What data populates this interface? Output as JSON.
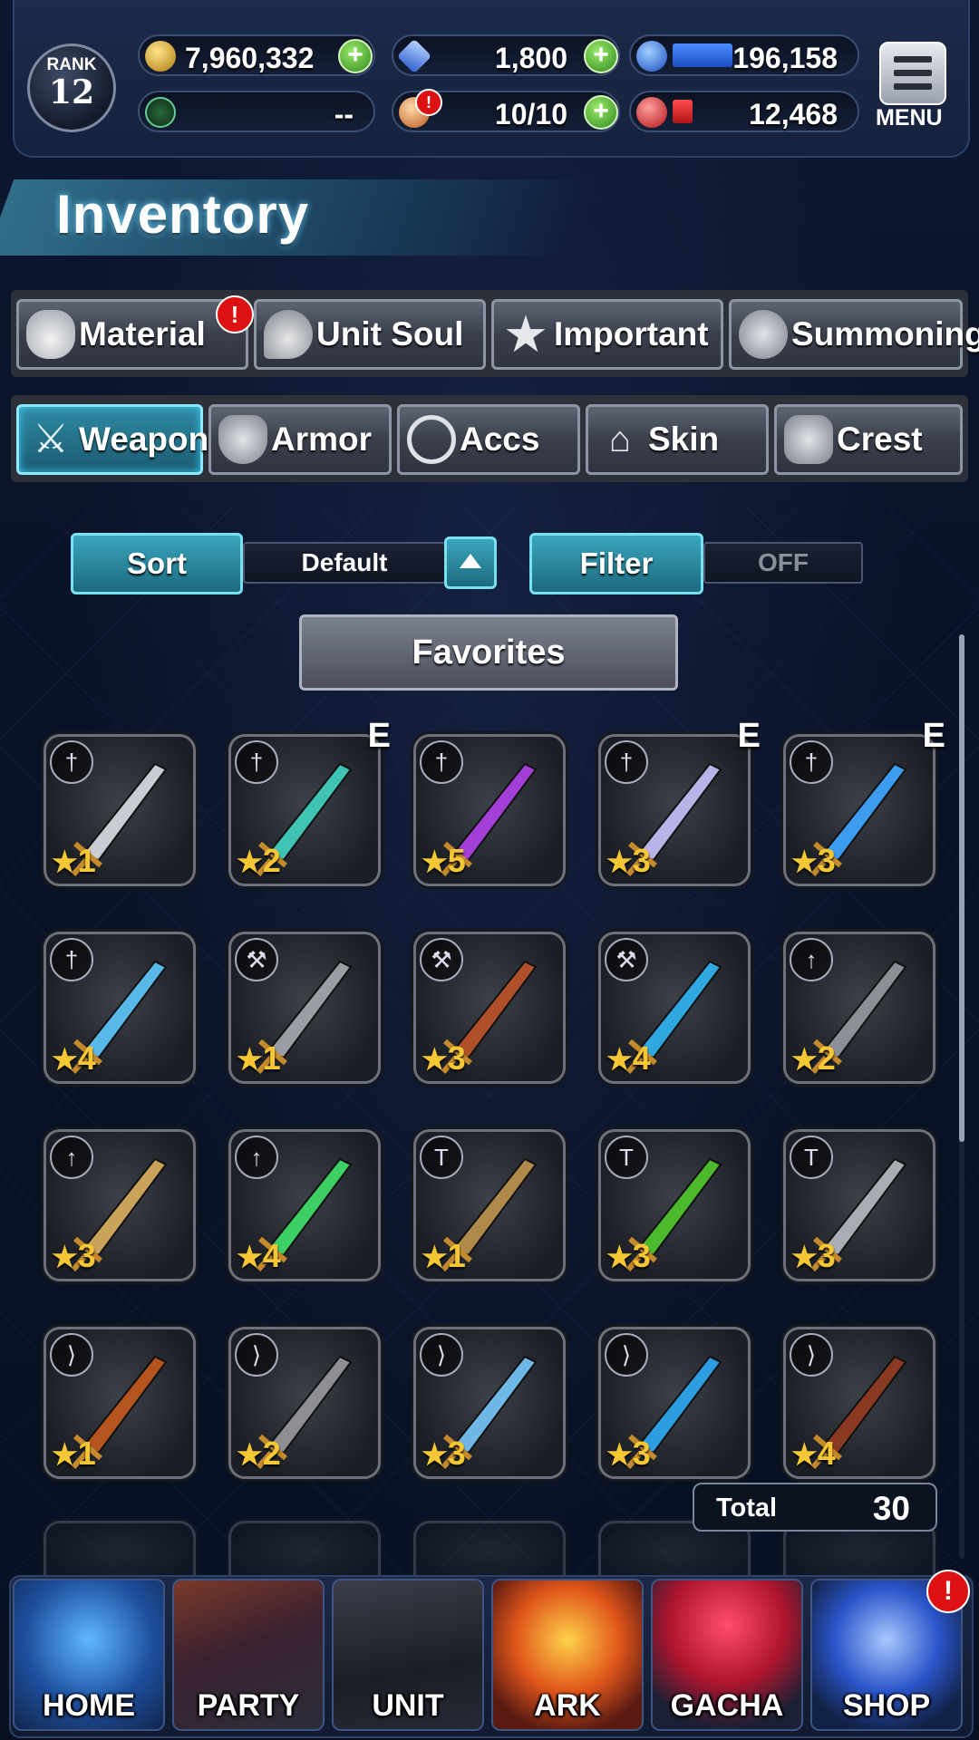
{
  "status": {
    "rank_label": "RANK",
    "rank_value": "12",
    "gil": "7,960,332",
    "lapis": "1,800",
    "energy_blue": "196,158",
    "arena_orb": "--",
    "stamina": "10/10",
    "energy_red": "12,468",
    "menu_label": "MENU"
  },
  "page": {
    "title": "Inventory"
  },
  "categories": [
    {
      "label": "Material",
      "alert": "!"
    },
    {
      "label": "Unit Soul"
    },
    {
      "label": "Important"
    },
    {
      "label": "Summoning"
    }
  ],
  "equip_tabs": [
    {
      "label": "Weapon",
      "active": true
    },
    {
      "label": "Armor"
    },
    {
      "label": "Accs"
    },
    {
      "label": "Skin"
    },
    {
      "label": "Crest"
    }
  ],
  "controls": {
    "sort_label": "Sort",
    "sort_value": "Default",
    "filter_label": "Filter",
    "filter_value": "OFF",
    "favorites_label": "Favorites"
  },
  "items": [
    {
      "type_icon": "sword-icon",
      "rarity": "1",
      "equipped": "",
      "color": "#c9ccd3"
    },
    {
      "type_icon": "sword-icon",
      "rarity": "2",
      "equipped": "E",
      "color": "#3fc4b4"
    },
    {
      "type_icon": "sword-icon",
      "rarity": "5",
      "equipped": "",
      "color": "#a13fd6"
    },
    {
      "type_icon": "sword-icon",
      "rarity": "3",
      "equipped": "E",
      "color": "#b9b4e8"
    },
    {
      "type_icon": "sword-icon",
      "rarity": "3",
      "equipped": "E",
      "color": "#3b9cf0"
    },
    {
      "type_icon": "sword-icon",
      "rarity": "4",
      "equipped": "",
      "color": "#58b9e8"
    },
    {
      "type_icon": "axe-icon",
      "rarity": "1",
      "equipped": "",
      "color": "#9a9da3"
    },
    {
      "type_icon": "axe-icon",
      "rarity": "3",
      "equipped": "",
      "color": "#b0502a"
    },
    {
      "type_icon": "axe-icon",
      "rarity": "4",
      "equipped": "",
      "color": "#2fa8e0"
    },
    {
      "type_icon": "spear-icon",
      "rarity": "2",
      "equipped": "",
      "color": "#8c9096"
    },
    {
      "type_icon": "spear-icon",
      "rarity": "3",
      "equipped": "",
      "color": "#c9a35a"
    },
    {
      "type_icon": "spear-icon",
      "rarity": "4",
      "equipped": "",
      "color": "#3ccf63"
    },
    {
      "type_icon": "hammer-icon",
      "rarity": "1",
      "equipped": "",
      "color": "#b08a4a"
    },
    {
      "type_icon": "hammer-icon",
      "rarity": "3",
      "equipped": "",
      "color": "#4cba2c"
    },
    {
      "type_icon": "hammer-icon",
      "rarity": "3",
      "equipped": "",
      "color": "#a9adb3"
    },
    {
      "type_icon": "bow-icon",
      "rarity": "1",
      "equipped": "",
      "color": "#b5541f"
    },
    {
      "type_icon": "bow-icon",
      "rarity": "2",
      "equipped": "",
      "color": "#8d8f93"
    },
    {
      "type_icon": "bow-icon",
      "rarity": "3",
      "equipped": "",
      "color": "#6fb8e6"
    },
    {
      "type_icon": "bow-icon",
      "rarity": "3",
      "equipped": "",
      "color": "#2b9de0"
    },
    {
      "type_icon": "bow-icon",
      "rarity": "4",
      "equipped": "",
      "color": "#8a3a22"
    }
  ],
  "total": {
    "label": "Total",
    "value": "30"
  },
  "nav": [
    {
      "label": "HOME"
    },
    {
      "label": "PARTY"
    },
    {
      "label": "UNIT"
    },
    {
      "label": "ARK"
    },
    {
      "label": "GACHA"
    },
    {
      "label": "SHOP",
      "alert": "!"
    }
  ],
  "colors": {
    "accent_teal": "#2f8ba4",
    "rarity_star": "#f5c735",
    "alert_red": "#dd1111",
    "gil_gold": "#e0b030",
    "lapis_blue": "#4a7fe8"
  }
}
